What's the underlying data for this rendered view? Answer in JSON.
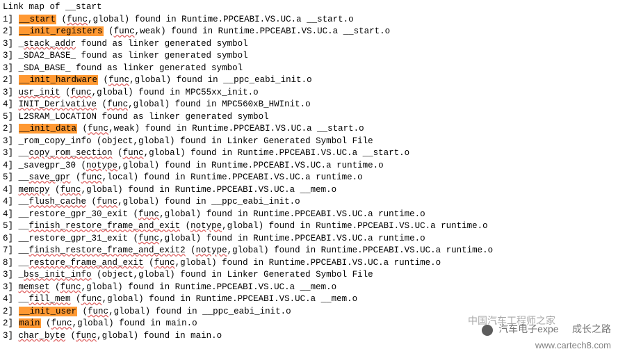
{
  "title": "Link map of __start",
  "lines": [
    {
      "indent": "  ",
      "idx": "1] ",
      "hl": "__start",
      "pre": null,
      "u": null,
      "post": " (",
      "u2": "func",
      "tail": ",global) found in Runtime.PPCEABI.VS.UC.a __start.o"
    },
    {
      "indent": "   ",
      "idx": "2] ",
      "hl": "__init_registers",
      "pre": null,
      "u": null,
      "post": " (",
      "u2": "func",
      "tail": ",weak) found in Runtime.PPCEABI.VS.UC.a __start.o"
    },
    {
      "indent": "    ",
      "idx": "3] ",
      "hl": null,
      "pre": "_",
      "u": "stack_addr",
      "post": " found as linker generated symbol",
      "u2": null,
      "tail": ""
    },
    {
      "indent": "    ",
      "idx": "3] ",
      "hl": null,
      "pre": "_SDA2_BASE_ found as linker generated symbol",
      "u": null,
      "post": "",
      "u2": null,
      "tail": ""
    },
    {
      "indent": "    ",
      "idx": "3] ",
      "hl": null,
      "pre": "_SDA_BASE_ found as linker generated symbol",
      "u": null,
      "post": "",
      "u2": null,
      "tail": ""
    },
    {
      "indent": "   ",
      "idx": "2] ",
      "hl": "__init_hardware",
      "pre": null,
      "u": null,
      "post": " (",
      "u2": "func",
      "tail": ",global) found in __ppc_eabi_init.o"
    },
    {
      "indent": "    ",
      "idx": "3] ",
      "hl": null,
      "pre": "",
      "u": "usr_init",
      "post": " (",
      "u2": "func",
      "tail": ",global) found in MPC55xx_init.o"
    },
    {
      "indent": "     ",
      "idx": "4] ",
      "hl": null,
      "pre": "",
      "u": "INIT_Derivative",
      "post": " (",
      "u2": "func",
      "tail": ",global) found in MPC560xB_HWInit.o"
    },
    {
      "indent": "      ",
      "idx": "5] ",
      "hl": null,
      "pre": "L2SRAM_LOCATION found as linker generated symbol",
      "u": null,
      "post": "",
      "u2": null,
      "tail": ""
    },
    {
      "indent": "   ",
      "idx": "2] ",
      "hl": "__init_data",
      "pre": null,
      "u": null,
      "post": " (",
      "u2": "func",
      "tail": ",weak) found in Runtime.PPCEABI.VS.UC.a __start.o"
    },
    {
      "indent": "    ",
      "idx": "3] ",
      "hl": null,
      "pre": "_rom_copy_info (object,global) found in Linker Generated Symbol File",
      "u": null,
      "post": "",
      "u2": null,
      "tail": ""
    },
    {
      "indent": "    ",
      "idx": "3] ",
      "hl": null,
      "pre": "__",
      "u": "copy_rom_section",
      "post": " (",
      "u2": "func",
      "tail": ",global) found in Runtime.PPCEABI.VS.UC.a __start.o"
    },
    {
      "indent": "     ",
      "idx": "4] ",
      "hl": null,
      "pre": "_savegpr_30 (",
      "u": "notype",
      "post": ",global) found in Runtime.PPCEABI.VS.UC.a runtime.o",
      "u2": null,
      "tail": ""
    },
    {
      "indent": "      ",
      "idx": "5] ",
      "hl": null,
      "pre": "__",
      "u": "save_gpr",
      "post": " (",
      "u2": "func",
      "tail": ",local) found in Runtime.PPCEABI.VS.UC.a runtime.o"
    },
    {
      "indent": "     ",
      "idx": "4] ",
      "hl": null,
      "pre": "",
      "u": "memcpy",
      "post": " (",
      "u2": "func",
      "tail": ",global) found in Runtime.PPCEABI.VS.UC.a __mem.o"
    },
    {
      "indent": "     ",
      "idx": "4] ",
      "hl": null,
      "pre": "__",
      "u": "flush_cache",
      "post": " (",
      "u2": "func",
      "tail": ",global) found in __ppc_eabi_init.o"
    },
    {
      "indent": "     ",
      "idx": "4] ",
      "hl": null,
      "pre": "__restore_gpr_30_exit (",
      "u": "func",
      "post": ",global) found in Runtime.PPCEABI.VS.UC.a runtime.o",
      "u2": null,
      "tail": ""
    },
    {
      "indent": "      ",
      "idx": "5] ",
      "hl": null,
      "pre": "__",
      "u": "finish_restore_frame_and_exit",
      "post": " (",
      "u2": "notype",
      "tail": ",global) found in Runtime.PPCEABI.VS.UC.a runtime.o"
    },
    {
      "indent": "       ",
      "idx": "6] ",
      "hl": null,
      "pre": "__restore_gpr_31_exit (",
      "u": "func",
      "post": ",global) found in Runtime.PPCEABI.VS.UC.a runtime.o",
      "u2": null,
      "tail": ""
    },
    {
      "indent": "        ",
      "idx": "7] ",
      "hl": null,
      "pre": "__",
      "u": "finish_restore_frame_and_exit2",
      "post": " (",
      "u2": "notype",
      "tail": ",global) found in Runtime.PPCEABI.VS.UC.a runtime.o"
    },
    {
      "indent": "         ",
      "idx": "8] ",
      "hl": null,
      "pre": "__",
      "u": "restore_frame_and_exit",
      "post": " (",
      "u2": "func",
      "tail": ",global) found in Runtime.PPCEABI.VS.UC.a runtime.o"
    },
    {
      "indent": "    ",
      "idx": "3] ",
      "hl": null,
      "pre": "_",
      "u": "bss_init_info",
      "post": " (object,global) found in Linker Generated Symbol File",
      "u2": null,
      "tail": ""
    },
    {
      "indent": "    ",
      "idx": "3] ",
      "hl": null,
      "pre": "",
      "u": "memset",
      "post": " (",
      "u2": "func",
      "tail": ",global) found in Runtime.PPCEABI.VS.UC.a __mem.o"
    },
    {
      "indent": "     ",
      "idx": "4] ",
      "hl": null,
      "pre": "__",
      "u": "fill_mem",
      "post": " (",
      "u2": "func",
      "tail": ",global) found in Runtime.PPCEABI.VS.UC.a __mem.o"
    },
    {
      "indent": "   ",
      "idx": "2] ",
      "hl": "__init_user",
      "pre": null,
      "u": null,
      "post": " (",
      "u2": "func",
      "tail": ",global) found in __ppc_eabi_init.o"
    },
    {
      "indent": "   ",
      "idx": "2] ",
      "hl": "main",
      "pre": null,
      "u": null,
      "post": " (",
      "u2": "func",
      "tail": ",global) found in main.o"
    },
    {
      "indent": "    ",
      "idx": "3] ",
      "hl": null,
      "pre": "",
      "u": "char_byte",
      "post": " (",
      "u2": "func",
      "tail": ",global) found in main.o"
    }
  ],
  "watermark": {
    "text1": "汽车电子expe",
    "text2": "成长之路",
    "overlay": "中国汽车工程师之家",
    "url": "www.cartech8.com"
  }
}
